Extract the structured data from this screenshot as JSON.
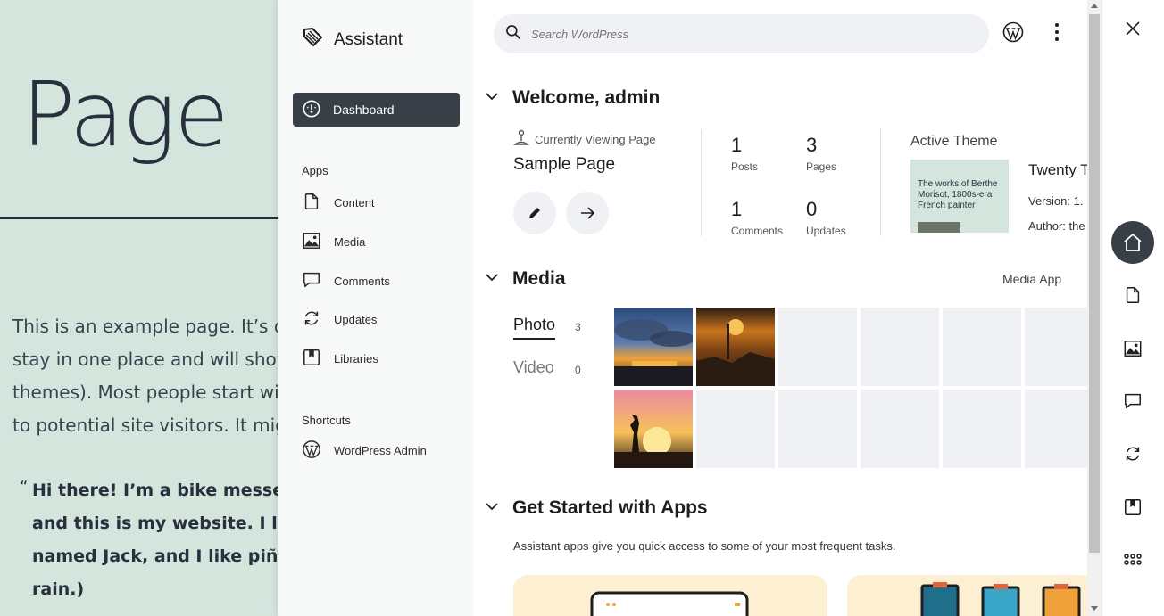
{
  "background_page": {
    "title": "Page",
    "paragraph_lines": [
      "This is an example page. It’s di",
      "stay in one place and will show",
      "themes). Most people start with",
      "to potential site visitors. It migh"
    ],
    "quote_mark": "“",
    "quote_lines": [
      "Hi there! I’m a bike messer",
      "and this is my website. I liv",
      "named Jack, and I like piña",
      "rain.)"
    ]
  },
  "sidebar": {
    "brand": "Assistant",
    "dashboard": "Dashboard",
    "apps_label": "Apps",
    "apps": [
      {
        "label": "Content",
        "icon": "page-icon"
      },
      {
        "label": "Media",
        "icon": "image-icon"
      },
      {
        "label": "Comments",
        "icon": "comment-icon"
      },
      {
        "label": "Updates",
        "icon": "update-icon"
      },
      {
        "label": "Libraries",
        "icon": "library-icon"
      }
    ],
    "shortcuts_label": "Shortcuts",
    "shortcuts": [
      {
        "label": "WordPress Admin",
        "icon": "wordpress-icon"
      }
    ]
  },
  "search": {
    "placeholder": "Search WordPress"
  },
  "welcome": {
    "title": "Welcome, admin",
    "currently_viewing": "Currently Viewing Page",
    "page_name": "Sample Page",
    "stats": [
      {
        "value": "1",
        "label": "Posts"
      },
      {
        "value": "3",
        "label": "Pages"
      },
      {
        "value": "1",
        "label": "Comments"
      },
      {
        "value": "0",
        "label": "Updates"
      }
    ],
    "active_theme_label": "Active Theme",
    "theme_name": "Twenty T",
    "theme_version": "Version: 1.",
    "theme_author": "Author: the",
    "theme_thumb_text": "The works of Berthe Morisot, 1800s-era French painter"
  },
  "media": {
    "title": "Media",
    "app_link": "Media App",
    "tabs": [
      {
        "label": "Photo",
        "count": "3"
      },
      {
        "label": "Video",
        "count": "0"
      }
    ]
  },
  "get_started": {
    "title": "Get Started with Apps",
    "description": "Assistant apps give you quick access to some of your most frequent tasks."
  },
  "colors": {
    "accent_dark": "#383f46",
    "background_page": "#d4e5de",
    "card": "#fdf0d2"
  }
}
